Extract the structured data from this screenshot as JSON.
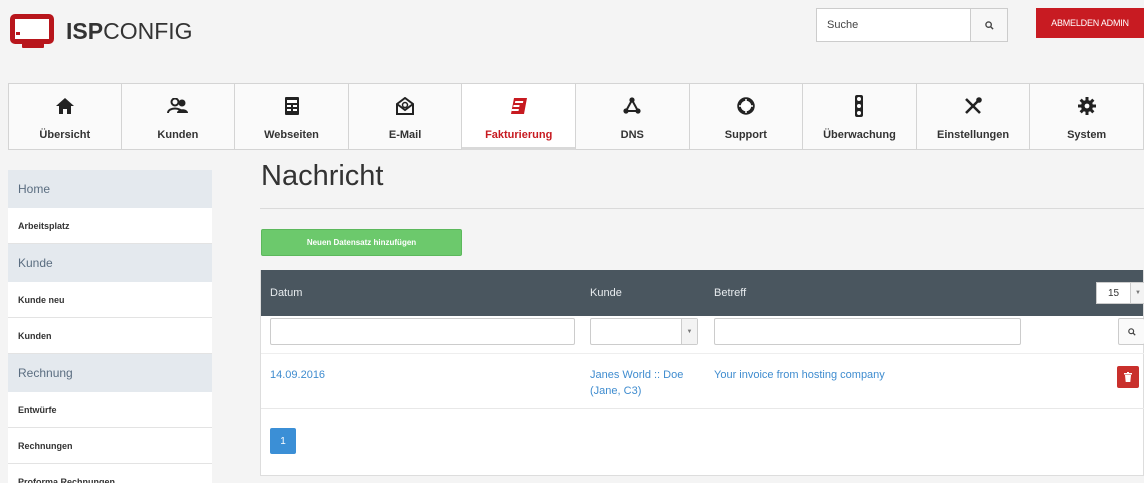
{
  "logo": {
    "brand_bold": "ISP",
    "brand_rest": "CONFIG"
  },
  "search": {
    "value": "Suche"
  },
  "logout_label": "ABMELDEN ADMIN",
  "tabs": [
    {
      "label": "Übersicht",
      "icon": "home-icon"
    },
    {
      "label": "Kunden",
      "icon": "users-icon"
    },
    {
      "label": "Webseiten",
      "icon": "webpage-icon"
    },
    {
      "label": "E-Mail",
      "icon": "envelope-icon"
    },
    {
      "label": "Fakturierung",
      "icon": "invoice-icon",
      "active": true
    },
    {
      "label": "DNS",
      "icon": "network-icon"
    },
    {
      "label": "Support",
      "icon": "lifebuoy-icon"
    },
    {
      "label": "Überwachung",
      "icon": "traffic-light-icon"
    },
    {
      "label": "Einstellungen",
      "icon": "tools-icon"
    },
    {
      "label": "System",
      "icon": "gear-icon"
    }
  ],
  "sidebar": {
    "sections": [
      {
        "title": "Home",
        "items": [
          "Arbeitsplatz"
        ]
      },
      {
        "title": "Kunde",
        "items": [
          "Kunde neu",
          "Kunden"
        ]
      },
      {
        "title": "Rechnung",
        "items": [
          "Entwürfe",
          "Rechnungen",
          "Proforma Rechnungen"
        ]
      }
    ]
  },
  "main": {
    "title": "Nachricht",
    "add_button": "Neuen Datensatz hinzufügen",
    "table": {
      "headers": {
        "datum": "Datum",
        "kunde": "Kunde",
        "betreff": "Betreff"
      },
      "per_page": "15",
      "rows": [
        {
          "datum": "14.09.2016",
          "kunde": "Janes World :: Doe (Jane, C3)",
          "betreff": "Your invoice from hosting company"
        }
      ]
    },
    "pagination": {
      "current": "1"
    }
  },
  "colors": {
    "brand_red": "#c81b22",
    "header_dark": "#4a565f",
    "link_blue": "#3f8ccf",
    "add_green": "#6cc96c",
    "page_blue": "#3b8fd6"
  }
}
